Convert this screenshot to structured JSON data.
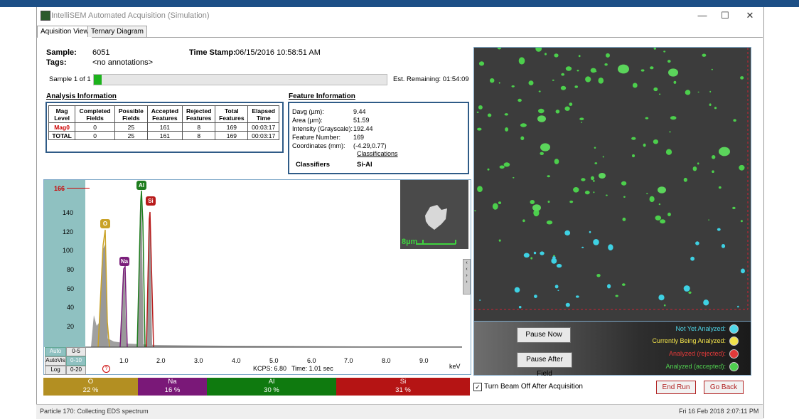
{
  "window": {
    "title": "IntelliSEM Automated Acquisition (Simulation)",
    "minimize": "—",
    "maximize": "☐",
    "close": "✕"
  },
  "tabs": [
    "Aquisition View",
    "Ternary Diagram"
  ],
  "sample": {
    "label": "Sample:",
    "value": "6051",
    "tags_label": "Tags:",
    "tags_value": "<no annotations>",
    "timestamp_label": "Time Stamp:",
    "timestamp_value": "06/15/2016 10:58:51 AM"
  },
  "progress": {
    "sample_text": "Sample 1 of 1",
    "remaining": "Est. Remaining: 01:54:09",
    "fraction": 0.027
  },
  "analysis": {
    "title": "Analysis Information",
    "headers": [
      [
        "Mag",
        "Level"
      ],
      [
        "Completed",
        "Fields"
      ],
      [
        "Possible",
        "Fields"
      ],
      [
        "Accepted",
        "Features"
      ],
      [
        "Rejected",
        "Features"
      ],
      [
        "Total",
        "Features"
      ],
      [
        "Elapsed",
        "Time"
      ]
    ],
    "rows": [
      [
        "Mag0",
        "0",
        "25",
        "161",
        "8",
        "169",
        "00:03:17"
      ],
      [
        "TOTAL",
        "0",
        "25",
        "161",
        "8",
        "169",
        "00:03:17"
      ]
    ]
  },
  "feature": {
    "title": "Feature Information",
    "rows": [
      {
        "k": "Davg (µm):",
        "v": "9.44"
      },
      {
        "k": "Area (µm):",
        "v": "51.59"
      },
      {
        "k": "Intensity (Grayscale):",
        "v": "192.44"
      },
      {
        "k": "Feature Number:",
        "v": "169"
      },
      {
        "k": "Coordinates (mm):",
        "v": "(-4.29,0.77)"
      }
    ],
    "classifications_link": "Classifications",
    "classifiers_label": "Classifiers",
    "classifiers_value": "Si-Al"
  },
  "spectrum": {
    "ymax_label": "166",
    "y_ticks": [
      "140",
      "120",
      "100",
      "80",
      "60",
      "40",
      "20"
    ],
    "x_ticks": [
      "1.0",
      "2.0",
      "3.0",
      "4.0",
      "5.0",
      "6.0",
      "7.0",
      "8.0",
      "9.0"
    ],
    "x_unit": "keV",
    "kcps": "KCPS: 6.80",
    "time": "Time: 1.01 sec",
    "scale_label": "8µm",
    "btn_auto": "Auto",
    "btn_autovis": "AutoVis",
    "btn_log": "Log",
    "btn_r1": "0-5",
    "btn_r2": "0-10",
    "btn_r3": "0-20",
    "help": "?",
    "peaks": [
      {
        "el": "O",
        "color": "#c9a227"
      },
      {
        "el": "Na",
        "color": "#7b1f7b"
      },
      {
        "el": "Al",
        "color": "#1e7d1e"
      },
      {
        "el": "Si",
        "color": "#b81b1b"
      }
    ]
  },
  "elements": [
    {
      "el": "O",
      "pct": "22 %",
      "color": "#b38f22",
      "frac": 0.22
    },
    {
      "el": "Na",
      "pct": "16 %",
      "color": "#7a1878",
      "frac": 0.16
    },
    {
      "el": "Al",
      "pct": "30 %",
      "color": "#0f7a0f",
      "frac": 0.3
    },
    {
      "el": "Si",
      "pct": "31 %",
      "color": "#b51414",
      "frac": 0.31
    }
  ],
  "controls": {
    "pause_now": "Pause Now",
    "pause_after": "Pause After Field",
    "legend": [
      {
        "text": "Not Yet Analyzed:",
        "color": "#4fd6e8"
      },
      {
        "text": "Currently Being Analyzed:",
        "color": "#f2e34a"
      },
      {
        "text": "Analyzed (rejected):",
        "color": "#e23a3a"
      },
      {
        "text": "Analyzed (accepted):",
        "color": "#4fcf4f"
      }
    ],
    "beam_off": "Turn Beam Off After Acquisition",
    "end_run": "End Run",
    "go_back": "Go Back"
  },
  "status": {
    "left": "Particle 170: Collecting EDS spectrum",
    "date": "Fri 16 Feb 2018",
    "time": "2:07:11 PM"
  }
}
